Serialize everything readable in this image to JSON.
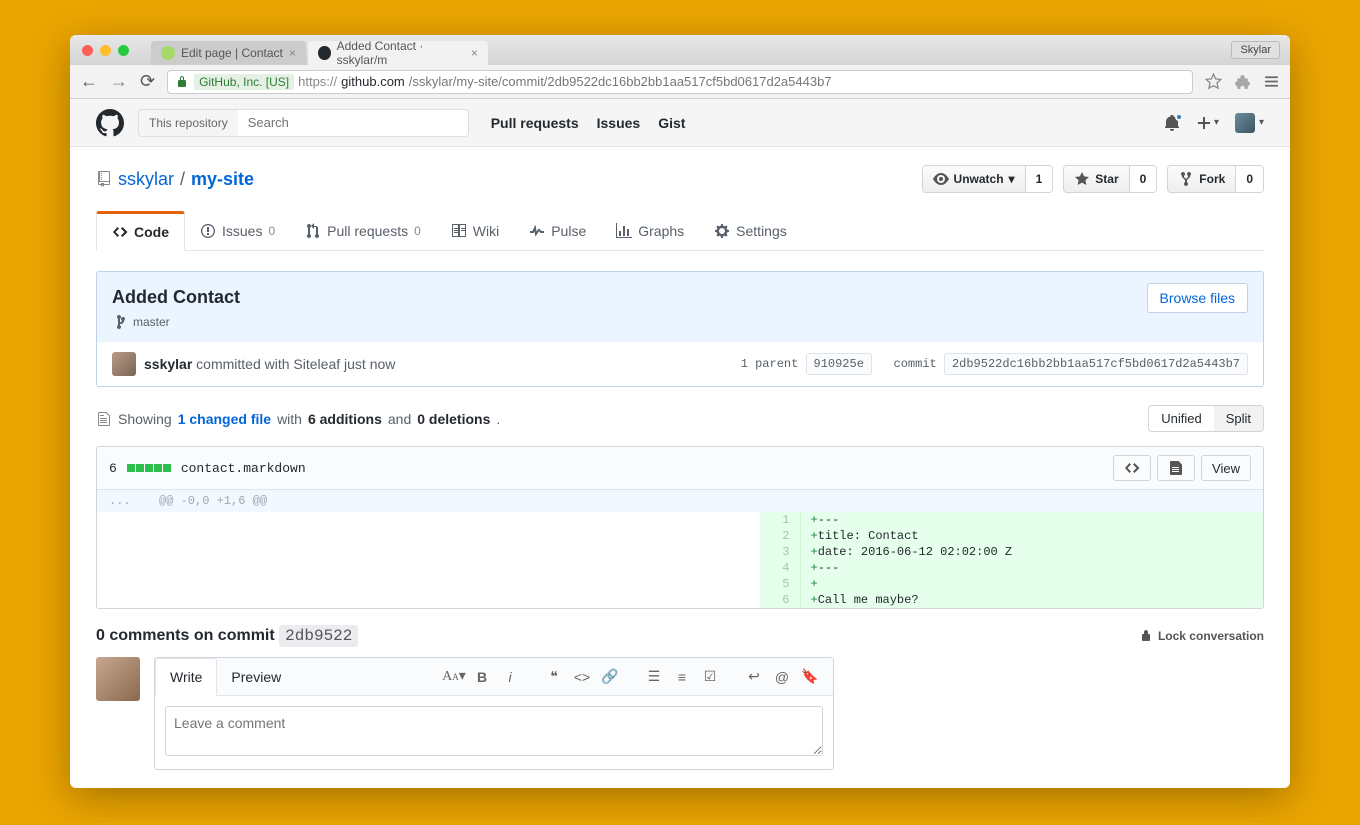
{
  "browser": {
    "userButton": "Skylar",
    "tabs": [
      {
        "title": "Edit page | Contact",
        "active": false
      },
      {
        "title": "Added Contact · sskylar/m",
        "active": true
      }
    ],
    "ssl_label": "GitHub, Inc. [US]",
    "url_prefix": "https://",
    "url_host": "github.com",
    "url_path": "/sskylar/my-site/commit/2db9522dc16bb2bb1aa517cf5bd0617d2a5443b7"
  },
  "header": {
    "scope": "This repository",
    "search_placeholder": "Search",
    "nav": {
      "pulls": "Pull requests",
      "issues": "Issues",
      "gist": "Gist"
    }
  },
  "repo": {
    "owner": "sskylar",
    "separator": "/",
    "name": "my-site",
    "watch": {
      "label": "Unwatch",
      "count": "1"
    },
    "star": {
      "label": "Star",
      "count": "0"
    },
    "fork": {
      "label": "Fork",
      "count": "0"
    }
  },
  "repoTabs": {
    "code": "Code",
    "issues": "Issues",
    "issues_count": "0",
    "pulls": "Pull requests",
    "pulls_count": "0",
    "wiki": "Wiki",
    "pulse": "Pulse",
    "graphs": "Graphs",
    "settings": "Settings"
  },
  "commit": {
    "title": "Added Contact",
    "branch": "master",
    "browse": "Browse files",
    "author": "sskylar",
    "committed_with": "committed with Siteleaf",
    "time": "just now",
    "parent_label": "1 parent",
    "parent_sha": "910925e",
    "sha_label": "commit",
    "sha": "2db9522dc16bb2bb1aa517cf5bd0617d2a5443b7"
  },
  "diffstat": {
    "showing": "Showing",
    "changed": "1 changed file",
    "with": "with",
    "additions": "6 additions",
    "and": "and",
    "deletions": "0 deletions",
    "period": ".",
    "unified": "Unified",
    "split": "Split"
  },
  "file": {
    "count": "6",
    "name": "contact.markdown",
    "view": "View",
    "hunk": "@@ -0,0 +1,6 @@",
    "lines": [
      {
        "n": "1",
        "text": "---"
      },
      {
        "n": "2",
        "text": "title: Contact"
      },
      {
        "n": "3",
        "text": "date: 2016-06-12 02:02:00 Z"
      },
      {
        "n": "4",
        "text": "---"
      },
      {
        "n": "5",
        "text": ""
      },
      {
        "n": "6",
        "text": "Call me maybe?"
      }
    ]
  },
  "comments": {
    "header": "0 comments on commit",
    "short_sha": "2db9522",
    "lock": "Lock conversation",
    "write": "Write",
    "preview": "Preview",
    "placeholder": "Leave a comment"
  }
}
